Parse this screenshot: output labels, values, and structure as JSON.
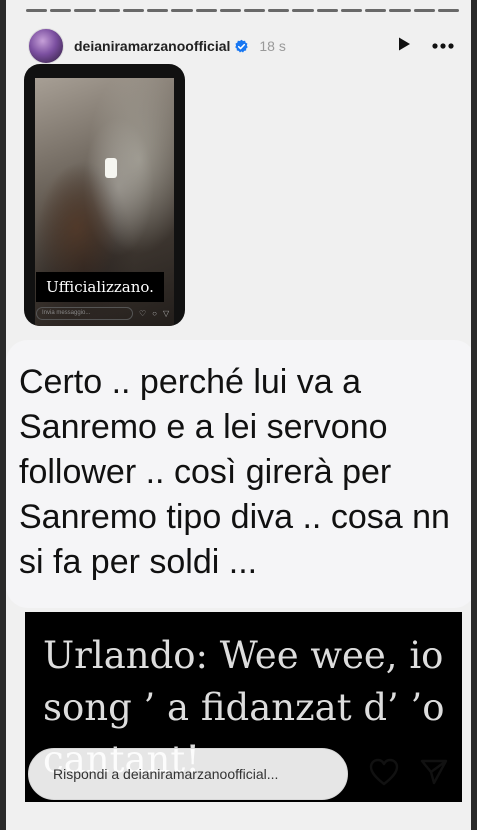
{
  "header": {
    "username": "deianiramarzanoofficial",
    "time": "18 s",
    "verified_icon": "verified-badge-icon",
    "play_icon": "play-icon",
    "more_icon": "more-horizontal-icon"
  },
  "story_card": {
    "caption": "Ufficializzano.",
    "reply_placeholder": "Invia messaggio..."
  },
  "comment": {
    "text": "Certo .. perché lui va a Sanremo e a lei servono follower .. così girerà per Sanremo tipo diva .. cosa nn si fa per soldi ..."
  },
  "quote": {
    "text": "Urlando: Wee wee, io song ’ a fidanzat d’ ’o cantant!"
  },
  "reply_bar": {
    "placeholder": "Rispondi a deianiramarzanoofficial..."
  },
  "colors": {
    "accent_blue": "#1877f2",
    "background": "#f0f0f0"
  }
}
